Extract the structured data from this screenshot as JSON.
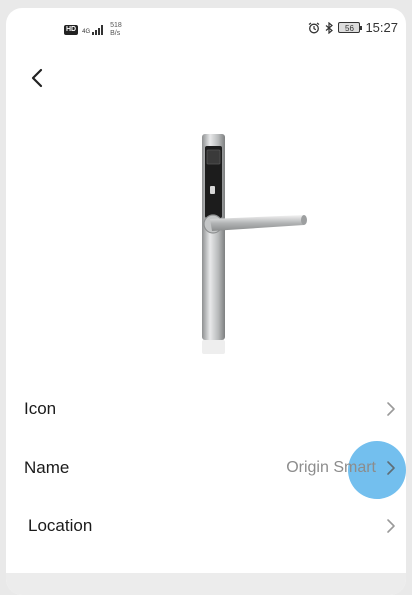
{
  "status_bar": {
    "hd_label": "HD",
    "network_label": "4G",
    "speed_value": "518",
    "speed_unit": "B/s",
    "battery_level": "56",
    "time": "15:27"
  },
  "device": {
    "image_name": "smart-door-lock-handle"
  },
  "settings_rows": [
    {
      "label": "Icon",
      "value": ""
    },
    {
      "label": "Name",
      "value": "Origin Smart"
    },
    {
      "label": "Location",
      "value": ""
    }
  ],
  "colors": {
    "accent": "#5ab4eb",
    "background": "#ffffff",
    "text": "#1a1a1a",
    "secondary_text": "#8c8c8c"
  }
}
